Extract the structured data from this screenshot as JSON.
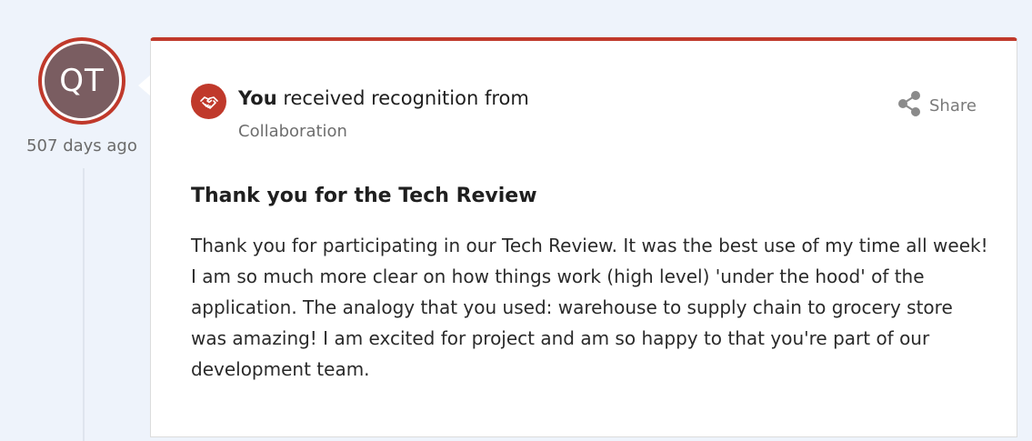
{
  "avatar": {
    "initials": "QT",
    "ring_color": "#c0392b",
    "fill_color": "#7a5d61"
  },
  "time_ago": "507 days ago",
  "recognition": {
    "you_label": "You",
    "received_text": "received recognition from",
    "category": "Collaboration",
    "badge_icon": "handshake-icon",
    "accent_color": "#c0392b"
  },
  "share": {
    "label": "Share",
    "icon": "share-icon"
  },
  "message": {
    "title": "Thank you for the Tech Review",
    "body": "Thank you for participating in our Tech Review. It was the best use of my time all week! I am so much more clear on how things work (high level) 'under the hood' of the application. The analogy that you used: warehouse to supply chain to grocery store was amazing! I am excited for project and am so happy to that you're part of our development team."
  }
}
